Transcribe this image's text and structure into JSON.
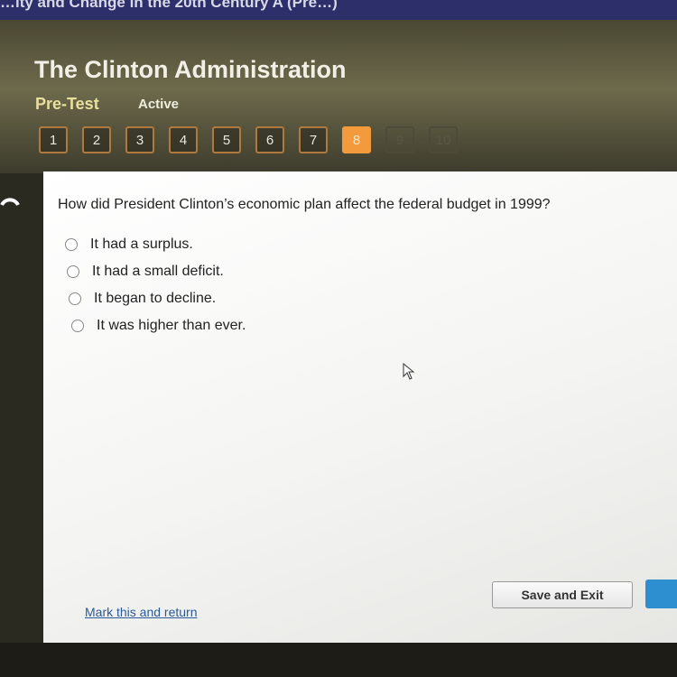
{
  "course_bar": {
    "title": "…ity and Change in the 20th Century A (Pre…)"
  },
  "header": {
    "title": "The Clinton Administration",
    "subtitle": "Pre-Test",
    "status": "Active",
    "questions": [
      {
        "label": "1",
        "state": "visited"
      },
      {
        "label": "2",
        "state": "visited"
      },
      {
        "label": "3",
        "state": "visited"
      },
      {
        "label": "4",
        "state": "visited"
      },
      {
        "label": "5",
        "state": "visited"
      },
      {
        "label": "6",
        "state": "visited"
      },
      {
        "label": "7",
        "state": "visited"
      },
      {
        "label": "8",
        "state": "current"
      },
      {
        "label": "9",
        "state": "unvisited"
      },
      {
        "label": "10",
        "state": "unvisited"
      }
    ],
    "current_color": "#f39a3c"
  },
  "question": {
    "text": "How did President Clinton’s economic plan affect the federal budget in 1999?",
    "options": [
      "It had a surplus.",
      "It had a small deficit.",
      "It began to decline.",
      "It was higher than ever."
    ]
  },
  "footer": {
    "mark_link": "Mark this and return",
    "save_button": "Save and Exit",
    "submit_color": "#2e8fd0"
  }
}
